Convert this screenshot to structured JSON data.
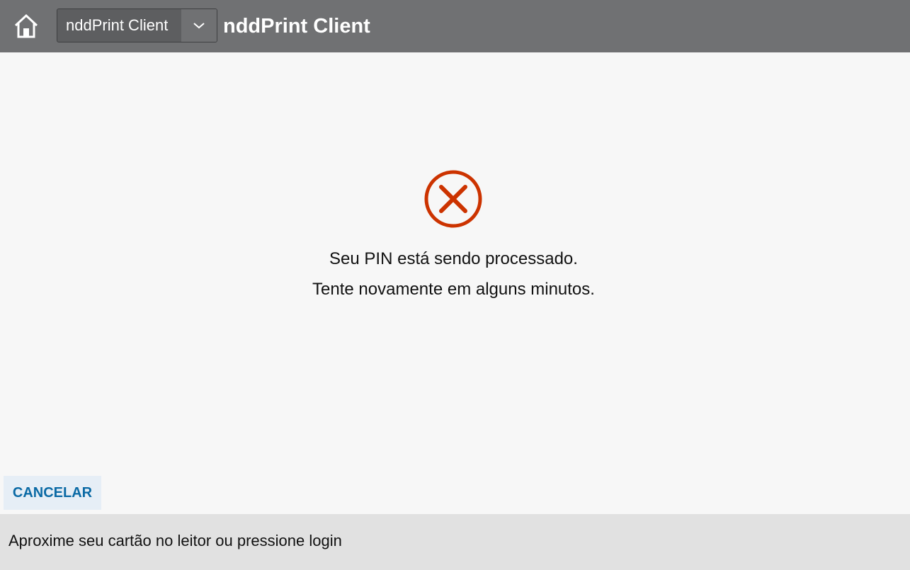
{
  "header": {
    "app_select": {
      "value": "nddPrint Client"
    },
    "title": "nddPrint Client"
  },
  "icons": {
    "home": "home-icon",
    "dropdown": "chevron-down-icon",
    "error": "error-x-circle-icon"
  },
  "message": {
    "line1": "Seu PIN está sendo processado.",
    "line2": "Tente novamente em alguns minutos."
  },
  "actions": {
    "cancel_label": "CANCELAR"
  },
  "status_bar": {
    "text": "Aproxime seu cartão no leitor ou pressione login"
  },
  "colors": {
    "header_bg": "#707173",
    "error_icon": "#cc3300",
    "cancel_text": "#0b6aa5",
    "cancel_bg": "#e6eef6",
    "status_bg": "#e1e1e1"
  }
}
